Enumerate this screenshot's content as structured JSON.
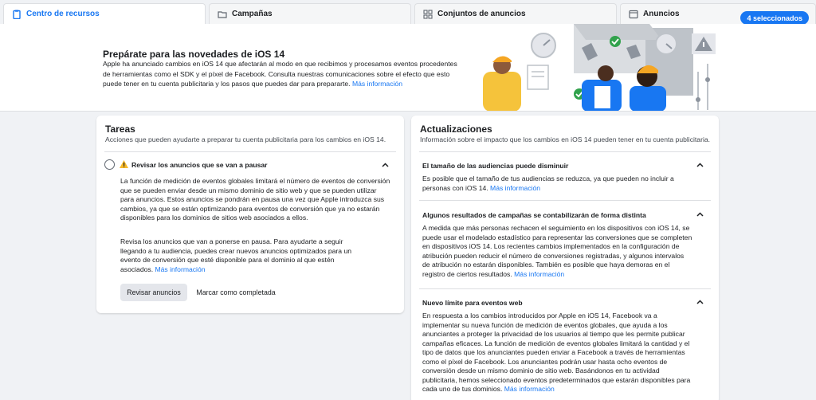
{
  "tabs": [
    {
      "label": "Centro de recursos",
      "icon": "clipboard-icon"
    },
    {
      "label": "Campañas",
      "icon": "folder-icon"
    },
    {
      "label": "Conjuntos de anuncios",
      "icon": "grid-icon"
    },
    {
      "label": "Anuncios",
      "icon": "ad-icon"
    }
  ],
  "selected_badge": "4 seleccionados",
  "hero": {
    "title": "Prepárate para las novedades de iOS 14",
    "body": "Apple ha anunciado cambios en iOS 14 que afectarán al modo en que recibimos y procesamos eventos procedentes de herramientas como el SDK y el píxel de Facebook. Consulta nuestras comunicaciones sobre el efecto que esto puede tener en tu cuenta publicitaria y los pasos que puedes dar para prepararte.",
    "link": "Más información"
  },
  "tareas": {
    "title": "Tareas",
    "subtitle": "Acciones que pueden ayudarte a preparar tu cuenta publicitaria para los cambios en iOS 14.",
    "task_title": "Revisar los anuncios que se van a pausar",
    "para1": "La función de medición de eventos globales limitará el número de eventos de conversión que se pueden enviar desde un mismo dominio de sitio web y que se pueden utilizar para anuncios. Estos anuncios se pondrán en pausa una vez que Apple introduzca sus cambios, ya que se están optimizando para eventos de conversión que ya no estarán disponibles para los dominios de sitios web asociados a ellos.",
    "para2": "Revisa los anuncios que van a ponerse en pausa. Para ayudarte a seguir llegando a tu audiencia, puedes crear nuevos anuncios optimizados para un evento de conversión que esté disponible para el dominio al que estén asociados.",
    "link": "Más información",
    "review_button": "Revisar anuncios",
    "complete_button": "Marcar como completada"
  },
  "updates": {
    "title": "Actualizaciones",
    "subtitle": "Información sobre el impacto que los cambios en iOS 14 pueden tener en tu cuenta publicitaria.",
    "items": [
      {
        "title": "El tamaño de las audiencias puede disminuir",
        "body": "Es posible que el tamaño de tus audiencias se reduzca, ya que pueden no incluir a personas con iOS 14.",
        "link": "Más información"
      },
      {
        "title": "Algunos resultados de campañas se contabilizarán de forma distinta",
        "body": "A medida que más personas rechacen el seguimiento en los dispositivos con iOS 14, se puede usar el modelado estadístico para representar las conversiones que se completen en dispositivos iOS 14. Los recientes cambios implementados en la configuración de atribución pueden reducir el número de conversiones registradas, y algunos intervalos de atribución no estarán disponibles. También es posible que haya demoras en el registro de ciertos resultados.",
        "link": "Más información"
      },
      {
        "title": "Nuevo límite para eventos web",
        "body": "En respuesta a los cambios introducidos por Apple en iOS 14, Facebook va a implementar su nueva función de medición de eventos globales, que ayuda a los anunciantes a proteger la privacidad de los usuarios al tiempo que les permite publicar campañas eficaces. La función de medición de eventos globales limitará la cantidad y el tipo de datos que los anunciantes pueden enviar a Facebook a través de herramientas como el píxel de Facebook. Los anunciantes podrán usar hasta ocho eventos de conversión desde un mismo dominio de sitio web. Basándonos en tu actividad publicitaria, hemos seleccionado eventos predeterminados que estarán disponibles para cada uno de tus dominios.",
        "link": "Más información"
      }
    ]
  },
  "colors": {
    "accent": "#1877f2",
    "warning": "#f7b928",
    "illustration_yellow": "#f5c33b"
  }
}
